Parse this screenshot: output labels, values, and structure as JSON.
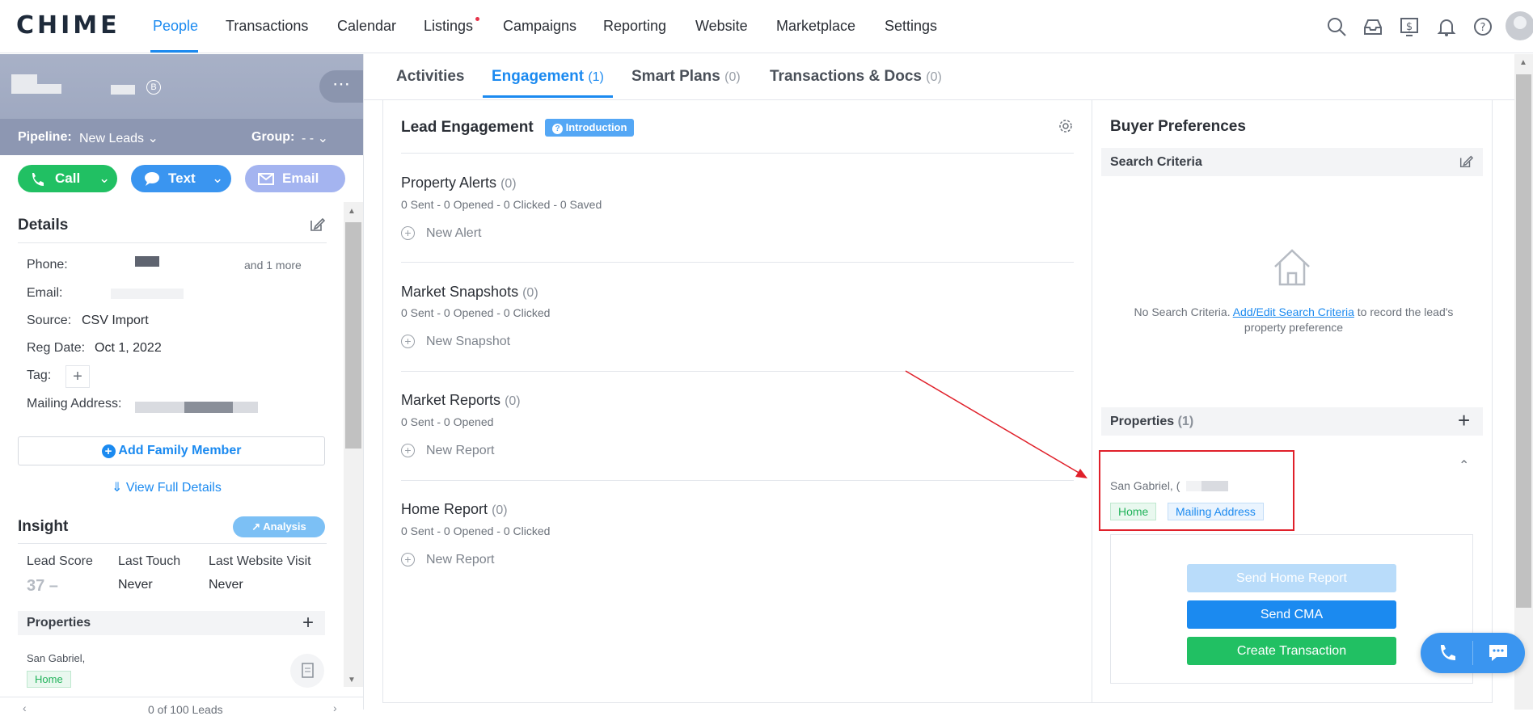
{
  "app": {
    "logo": "CHIME"
  },
  "nav": {
    "items": [
      "People",
      "Transactions",
      "Calendar",
      "Listings",
      "Campaigns",
      "Reporting",
      "Website",
      "Marketplace",
      "Settings"
    ],
    "active": "People"
  },
  "lead": {
    "badge": "B",
    "more": "⋯",
    "pipeline_label": "Pipeline:",
    "pipeline_value": "New Leads",
    "group_label": "Group:",
    "group_value": "- -",
    "actions": {
      "call": "Call",
      "text": "Text",
      "email": "Email"
    }
  },
  "details": {
    "title": "Details",
    "phone_label": "Phone:",
    "phone_more": "and 1 more",
    "email_label": "Email:",
    "source_label": "Source:",
    "source_value": "CSV Import",
    "reg_label": "Reg Date:",
    "reg_value": "Oct 1, 2022",
    "tag_label": "Tag:",
    "mailing_label": "Mailing Address:",
    "add_family": "Add Family Member",
    "view_full": "View Full Details"
  },
  "insight": {
    "title": "Insight",
    "analysis": "Analysis",
    "lead_score_label": "Lead Score",
    "lead_score_value": "37 –",
    "last_touch_label": "Last Touch",
    "last_touch_value": "Never",
    "last_visit_label": "Last Website Visit",
    "last_visit_value": "Never",
    "properties_title": "Properties",
    "property_city": "San Gabriel,",
    "property_tag": "Home",
    "footer_text": "0 of 100 Leads"
  },
  "tabs": [
    {
      "label": "Activities",
      "count": ""
    },
    {
      "label": "Engagement",
      "count": "(1)"
    },
    {
      "label": "Smart Plans",
      "count": "(0)"
    },
    {
      "label": "Transactions & Docs",
      "count": "(0)"
    }
  ],
  "engagement": {
    "title": "Lead Engagement",
    "badge": "Introduction",
    "sections": [
      {
        "title": "Property Alerts",
        "count": "(0)",
        "stats": "0 Sent - 0 Opened - 0 Clicked - 0 Saved",
        "action": "New Alert"
      },
      {
        "title": "Market Snapshots",
        "count": "(0)",
        "stats": "0 Sent - 0 Opened - 0 Clicked",
        "action": "New Snapshot"
      },
      {
        "title": "Market Reports",
        "count": "(0)",
        "stats": "0 Sent - 0 Opened",
        "action": "New Report"
      },
      {
        "title": "Home Report",
        "count": "(0)",
        "stats": "0 Sent - 0 Opened - 0 Clicked",
        "action": "New Report"
      }
    ]
  },
  "buyer": {
    "title": "Buyer Preferences",
    "search_criteria": "Search Criteria",
    "no_criteria_pre": "No Search Criteria.",
    "no_criteria_link": "Add/Edit Search Criteria",
    "no_criteria_post": "to record the lead's property preference",
    "properties_label": "Properties",
    "properties_count": "(1)",
    "property_city": "San Gabriel, (",
    "tag_home": "Home",
    "tag_mailing": "Mailing Address",
    "btn_send_home_report": "Send Home Report",
    "btn_send_cma": "Send CMA",
    "btn_create_transaction": "Create Transaction"
  },
  "colors": {
    "accent": "#1b8af0",
    "green": "#21c063",
    "annotation_red": "#e0202a"
  }
}
